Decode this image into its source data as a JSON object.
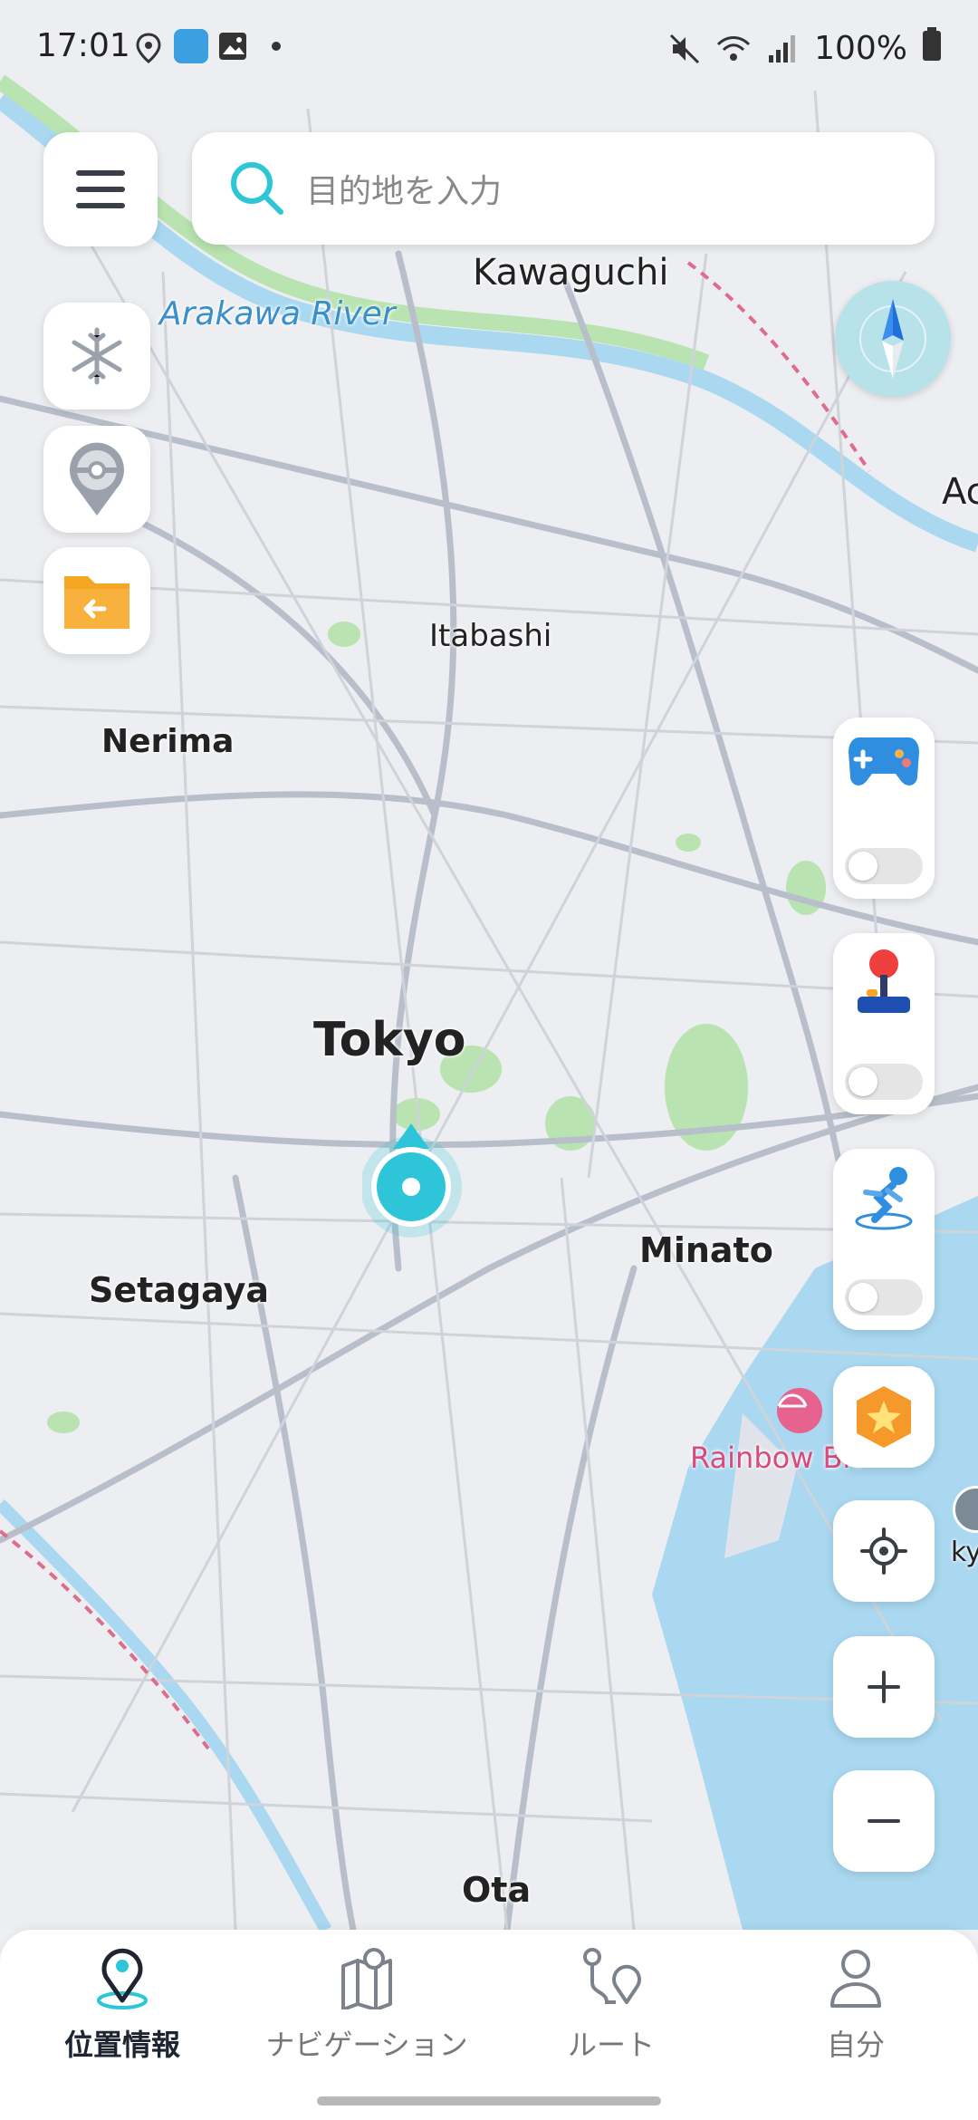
{
  "status": {
    "time": "17:01",
    "battery": "100%"
  },
  "search": {
    "placeholder": "目的地を入力"
  },
  "map": {
    "labels": {
      "kawaguchi": "Kawaguchi",
      "arakawa": "Arakawa River",
      "itabashi": "Itabashi",
      "nerima": "Nerima",
      "tokyo": "Tokyo",
      "minato": "Minato",
      "setagaya": "Setagaya",
      "rainbow": "Rainbow Bri",
      "ota": "Ota",
      "edge_right1": "Ac",
      "edge_right2": "kyo"
    }
  },
  "colors": {
    "accent": "#2ec5d8",
    "water": "#a9d8f0",
    "park": "#b9e3b0",
    "road": "#c4c9d2"
  },
  "nav": {
    "items": [
      {
        "label": "位置情報",
        "icon": "location-pin-icon",
        "active": true
      },
      {
        "label": "ナビゲーション",
        "icon": "map-icon",
        "active": false
      },
      {
        "label": "ルート",
        "icon": "route-icon",
        "active": false
      },
      {
        "label": "自分",
        "icon": "person-icon",
        "active": false
      }
    ]
  }
}
